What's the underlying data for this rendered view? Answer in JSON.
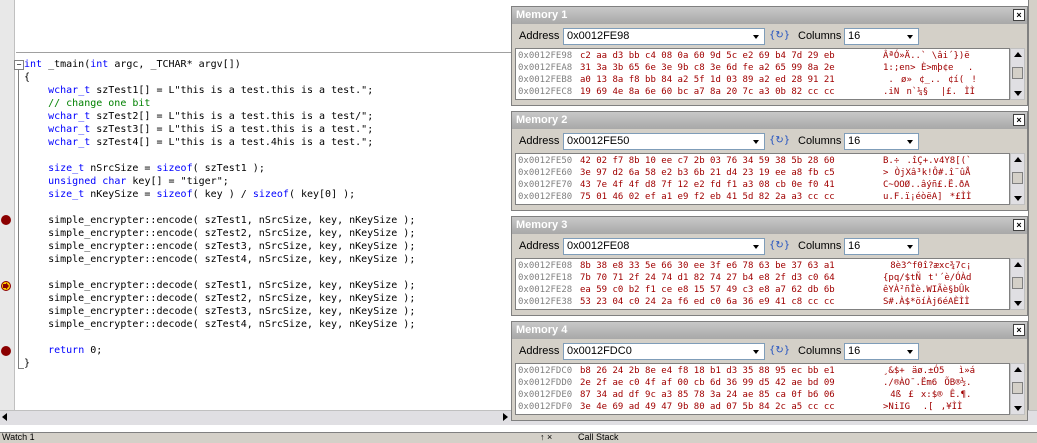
{
  "code": {
    "lines": [
      {
        "text": "int _tmain(int argc, _TCHAR* argv[])",
        "kind": "normal"
      },
      {
        "text": "{",
        "kind": "normal"
      },
      {
        "text": "    wchar_t szTest1[] = L\"this is a test.this is a test.\";",
        "kind": "normal"
      },
      {
        "text": "    // change one bit",
        "kind": "comment"
      },
      {
        "text": "    wchar_t szTest2[] = L\"this is a test.this is a test/\";",
        "kind": "normal"
      },
      {
        "text": "    wchar_t szTest3[] = L\"this iS a test.this is a test.\";",
        "kind": "normal"
      },
      {
        "text": "    wchar_t szTest4[] = L\"this is a test.4his is a test.\";",
        "kind": "normal"
      },
      {
        "text": "",
        "kind": "normal"
      },
      {
        "text": "    size_t nSrcSize = sizeof( szTest1 );",
        "kind": "normal"
      },
      {
        "text": "    unsigned char key[] = \"tiger\";",
        "kind": "normal"
      },
      {
        "text": "    size_t nKeySize = sizeof( key ) / sizeof( key[0] );",
        "kind": "normal"
      },
      {
        "text": "",
        "kind": "normal"
      },
      {
        "text": "    simple_encrypter::encode( szTest1, nSrcSize, key, nKeySize );",
        "kind": "normal"
      },
      {
        "text": "    simple_encrypter::encode( szTest2, nSrcSize, key, nKeySize );",
        "kind": "normal"
      },
      {
        "text": "    simple_encrypter::encode( szTest3, nSrcSize, key, nKeySize );",
        "kind": "normal"
      },
      {
        "text": "    simple_encrypter::encode( szTest4, nSrcSize, key, nKeySize );",
        "kind": "normal"
      },
      {
        "text": "",
        "kind": "normal"
      },
      {
        "text": "    simple_encrypter::decode( szTest1, nSrcSize, key, nKeySize );",
        "kind": "normal"
      },
      {
        "text": "    simple_encrypter::decode( szTest2, nSrcSize, key, nKeySize );",
        "kind": "normal"
      },
      {
        "text": "    simple_encrypter::decode( szTest3, nSrcSize, key, nKeySize );",
        "kind": "normal"
      },
      {
        "text": "    simple_encrypter::decode( szTest4, nSrcSize, key, nKeySize );",
        "kind": "normal"
      },
      {
        "text": "",
        "kind": "normal"
      },
      {
        "text": "    return 0;",
        "kind": "normal"
      },
      {
        "text": "}",
        "kind": "normal"
      }
    ],
    "fold_symbol": "−"
  },
  "memory_windows": [
    {
      "title": "Memory 1",
      "address_label": "Address",
      "address": "0x0012FE98",
      "columns_label": "Columns",
      "columns": "16",
      "rows": [
        {
          "addr": "0x0012FE98",
          "hex": "c2 aa d3 bb c4 08 0a 60 9d 5c e2 69 b4 7d 29 eb",
          "ascii": "ÂªÓ»Ä..`\\âi´})ë"
        },
        {
          "addr": "0x0012FEA8",
          "hex": "31 3a 3b 65 6e 3e 9b c8 3e 6d fe a2 65 99 8a 2e",
          "ascii": "1:;en>È>mþ¢e."
        },
        {
          "addr": "0x0012FEB8",
          "hex": "a0 13 8a f8 bb 84 a2 5f 1d 03 89 a2 ed 28 91 21",
          "ascii": " .ø»¢_..¢í(!"
        },
        {
          "addr": "0x0012FEC8",
          "hex": "19 69 4e 8a 6e 60 bc a7 8a 20 7c a3 0b 82 cc cc",
          "ascii": ".iNn`¼§ |£.ÌÌ"
        }
      ]
    },
    {
      "title": "Memory 2",
      "address_label": "Address",
      "address": "0x0012FE50",
      "columns_label": "Columns",
      "columns": "16",
      "rows": [
        {
          "addr": "0x0012FE50",
          "hex": "42 02 f7 8b 10 ee c7 2b 03 76 34 59 38 5b 28 60",
          "ascii": "B.÷.îÇ+.v4Y8[(`"
        },
        {
          "addr": "0x0012FE60",
          "hex": "3e 97 d2 6a 58 e2 b3 6b 21 d4 23 19 ee a8 fb c5",
          "ascii": ">ÒjXâ³k!Ô#.î¨ûÅ"
        },
        {
          "addr": "0x0012FE70",
          "hex": "43 7e 4f 4f d8 7f 12 e2 fd f1 a3 08 cb 0e f0 41",
          "ascii": "C~OOØ..âýñ£.Ë.ðA"
        },
        {
          "addr": "0x0012FE80",
          "hex": "75 01 46 02 ef a1 e9 f2 eb 41 5d 82 2a a3 cc cc",
          "ascii": "u.F.ï¡éòëA]*£ÌÌ"
        }
      ]
    },
    {
      "title": "Memory 3",
      "address_label": "Address",
      "address": "0x0012FE08",
      "columns_label": "Columns",
      "columns": "16",
      "rows": [
        {
          "addr": "0x0012FE08",
          "hex": "8b 38 e8 33 5e 66 30 ee 3f e6 78 63 be 37 63 a1",
          "ascii": "8è3^f0î?æxc¾7c¡"
        },
        {
          "addr": "0x0012FE18",
          "hex": "7b 70 71 2f 24 74 d1 82 74 27 b4 e8 2f d3 c0 64",
          "ascii": "{pq/$tÑt'´è/ÓÀd"
        },
        {
          "addr": "0x0012FE28",
          "hex": "ea 59 c0 b2 f1 ce e8 15 57 49 c3 e8 a7 62 db 6b",
          "ascii": "êYÀ²ñÎè.WIÃè§bÛk"
        },
        {
          "addr": "0x0012FE38",
          "hex": "53 23 04 c0 24 2a f6 ed c0 6a 36 e9 41 c8 cc cc",
          "ascii": "S#.À$*öíÀj6éAÈÌÌ"
        }
      ]
    },
    {
      "title": "Memory 4",
      "address_label": "Address",
      "address": "0x0012FDC0",
      "columns_label": "Columns",
      "columns": "16",
      "rows": [
        {
          "addr": "0x0012FDC0",
          "hex": "b8 26 24 2b 8e e4 f8 18 b1 d3 35 88 95 ec bb e1",
          "ascii": "¸&$+äø.±Ó5ì»á"
        },
        {
          "addr": "0x0012FDD0",
          "hex": "2e 2f ae c0 4f af 00 cb 6d 36 99 d5 42 ae bd 09",
          "ascii": "./®ÀO¯.Ëm6ÕB®½."
        },
        {
          "addr": "0x0012FDE0",
          "hex": "87 34 ad df 9c a3 85 78 3a 24 ae 85 ca 0f b6 06",
          "ascii": "4­ß£x:$®Ê.¶."
        },
        {
          "addr": "0x0012FDF0",
          "hex": "3e 4e 69 ad 49 47 9b 80 ad 07 5b 84 2c a5 cc cc",
          "ascii": ">Ni­IG­.[,¥ÌÌ"
        }
      ]
    }
  ],
  "status": {
    "left": "Watch 1",
    "pin": "↑ ×",
    "right": "Call Stack"
  },
  "colors": {
    "keyword": "#0000ff",
    "comment": "#008000",
    "memory_value": "#a00000",
    "breakpoint": "#8b0000"
  }
}
